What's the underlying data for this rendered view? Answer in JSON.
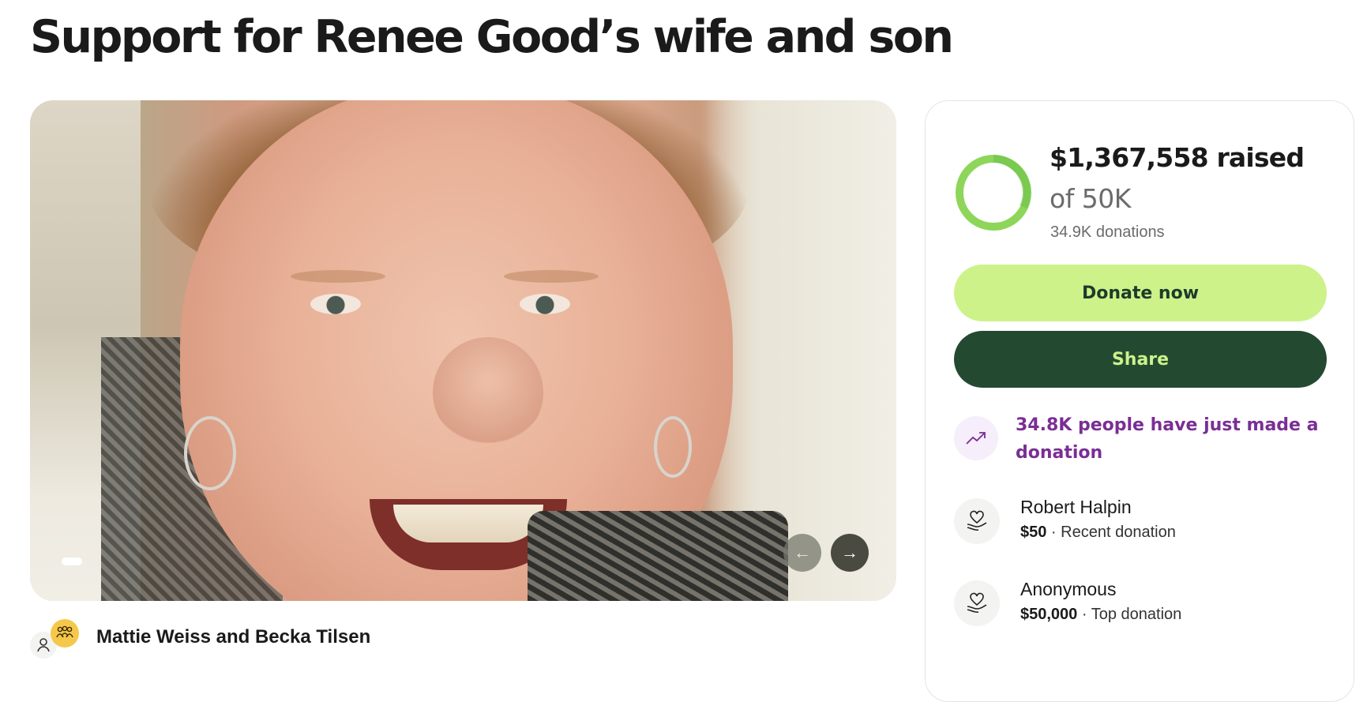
{
  "page": {
    "title": "Support for Renee Good’s wife and son"
  },
  "gallery": {
    "image_alt": "Photo of a smiling woman",
    "active_slide": 1,
    "prev_icon": "arrow-left-icon",
    "next_icon": "arrow-right-icon"
  },
  "organizer": {
    "name": "Mattie Weiss and Becka Tilsen",
    "icons": [
      "user-icon",
      "team-icon"
    ]
  },
  "progress": {
    "raised_text": "$1,367,558 raised",
    "goal_text": "of 50K",
    "donations_text": "34.9K donations",
    "progress_fraction": 1.0,
    "ring_color": "#8ed65a"
  },
  "actions": {
    "donate_label": "Donate now",
    "share_label": "Share",
    "donate_color": "#cdf28a",
    "share_color": "#234a31"
  },
  "trending": {
    "text": "34.8K people have just made a donation",
    "icon": "trending-up-icon",
    "color": "#7a2e95"
  },
  "donations": [
    {
      "name": "Robert Halpin",
      "amount": "$50",
      "label": "Recent donation",
      "icon": "heart-hand-icon"
    },
    {
      "name": "Anonymous",
      "amount": "$50,000",
      "label": "Top donation",
      "icon": "heart-hand-icon"
    }
  ]
}
